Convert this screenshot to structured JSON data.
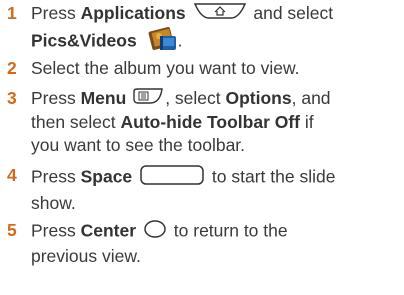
{
  "steps": [
    {
      "number": "1",
      "line1": {
        "t1": "Press ",
        "b1": "Applications",
        "t2": " and select"
      },
      "line2": {
        "b1": "Pics&Videos",
        "t2": "."
      },
      "icons": [
        "applications-key-icon",
        "pics-videos-app-icon"
      ]
    },
    {
      "number": "2",
      "line1": {
        "t1": "Select the album you want to view."
      }
    },
    {
      "number": "3",
      "line1": {
        "t1": "Press ",
        "b1": "Menu",
        "t2": ", select ",
        "b2": "Options",
        "t3": ", and"
      },
      "line2": {
        "t1": "then select ",
        "b1": "Auto-hide Toolbar Off",
        "t2": " if"
      },
      "line3": {
        "t1": "you want to see the toolbar."
      },
      "icons": [
        "menu-key-icon"
      ]
    },
    {
      "number": "4",
      "line1": {
        "t1": "Press ",
        "b1": "Space",
        "t2": " to start the slide"
      },
      "line2": {
        "t1": "show."
      },
      "icons": [
        "space-key-icon"
      ]
    },
    {
      "number": "5",
      "line1": {
        "t1": "Press ",
        "b1": "Center",
        "t2": " to return to the"
      },
      "line2": {
        "t1": "previous view."
      },
      "icons": [
        "center-key-icon"
      ]
    }
  ],
  "colors": {
    "step_number": "#d26a1a",
    "body_text": "#3a3a3a"
  }
}
